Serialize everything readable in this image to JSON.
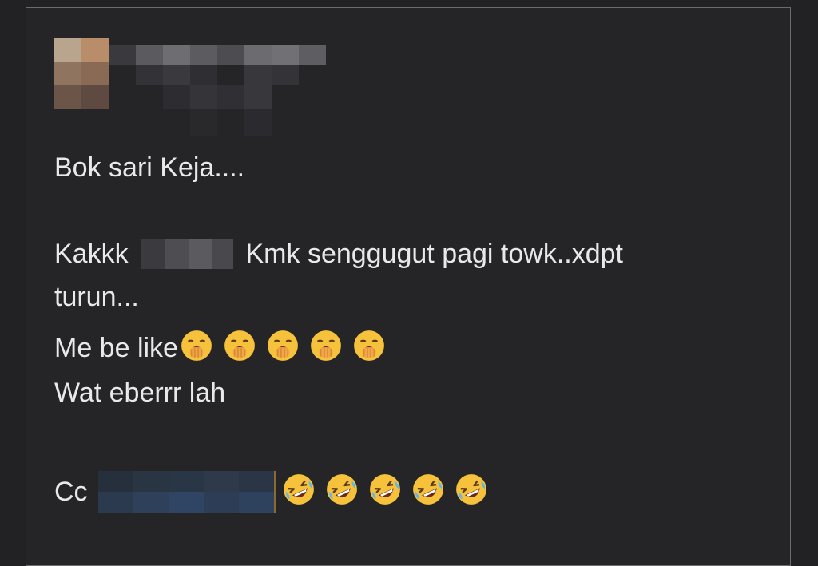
{
  "post": {
    "author_redacted": true,
    "lines": {
      "line1": "Bok sari Keja....",
      "line2_a": "Kakkk",
      "line2_b": "Kmk senggugut pagi towk..xdpt",
      "line3": "turun...",
      "line4": "Me be like",
      "line5": "Wat eberrr lah",
      "line6": "Cc"
    },
    "emoji": {
      "yawn": "yawning-hand-over-mouth-emoji",
      "laugh": "rolling-on-floor-laughing-emoji"
    }
  },
  "colors": {
    "background": "#222225",
    "text": "#e9e9ea",
    "border": "#6b6b70",
    "emoji_face": "#f6c13b"
  }
}
